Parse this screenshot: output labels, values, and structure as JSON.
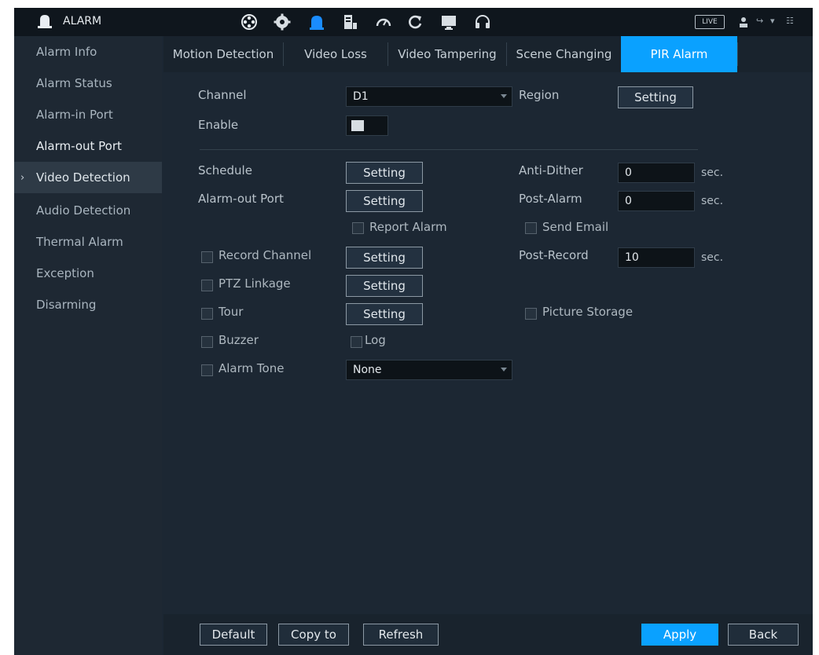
{
  "app": {
    "title": "ALARM"
  },
  "topbar": {
    "icons": [
      "film-reel-icon",
      "gear-icon",
      "alarm-bell-icon",
      "storage-icon",
      "gauge-icon",
      "refresh-icon",
      "monitor-icon",
      "headset-icon"
    ],
    "live_label": "LIVE",
    "user_icon": "user-icon",
    "logout_label": "↪",
    "grid_label": "☷"
  },
  "sidebar": {
    "items": [
      {
        "label": "Alarm Info"
      },
      {
        "label": "Alarm Status"
      },
      {
        "label": "Alarm-in Port"
      },
      {
        "label": "Alarm-out Port"
      },
      {
        "label": "Video Detection"
      },
      {
        "label": "Audio Detection"
      },
      {
        "label": "Thermal Alarm"
      },
      {
        "label": "Exception"
      },
      {
        "label": "Disarming"
      }
    ],
    "active_chevron": "›"
  },
  "tabs": [
    {
      "label": "Motion Detection"
    },
    {
      "label": "Video Loss"
    },
    {
      "label": "Video Tampering"
    },
    {
      "label": "Scene Changing"
    },
    {
      "label": "PIR Alarm"
    }
  ],
  "form": {
    "channel_label": "Channel",
    "channel_value": "D1",
    "region_label": "Region",
    "region_button": "Setting",
    "enable_label": "Enable",
    "schedule_label": "Schedule",
    "schedule_button": "Setting",
    "alarm_out_label": "Alarm-out Port",
    "alarm_out_button": "Setting",
    "report_alarm_label": "Report Alarm",
    "send_email_label": "Send Email",
    "record_channel_label": "Record Channel",
    "record_channel_button": "Setting",
    "ptz_label": "PTZ Linkage",
    "ptz_button": "Setting",
    "tour_label": "Tour",
    "tour_button": "Setting",
    "picture_storage_label": "Picture Storage",
    "buzzer_label": "Buzzer",
    "log_label": "Log",
    "alarm_tone_label": "Alarm Tone",
    "alarm_tone_value": "None",
    "anti_dither_label": "Anti-Dither",
    "anti_dither_value": "0",
    "post_alarm_label": "Post-Alarm",
    "post_alarm_value": "0",
    "post_record_label": "Post-Record",
    "post_record_value": "10",
    "unit_sec": "sec."
  },
  "bottom": {
    "default_label": "Default",
    "copy_label": "Copy to",
    "refresh_label": "Refresh",
    "apply_label": "Apply",
    "back_label": "Back"
  },
  "colors": {
    "accent": "#0aa1ff",
    "bg": "#1c2733",
    "topbar": "#0f161d"
  }
}
